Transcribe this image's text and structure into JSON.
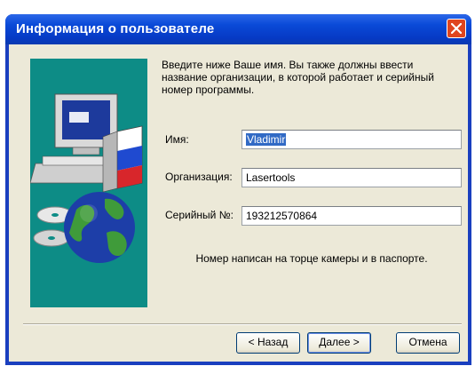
{
  "window": {
    "title": "Информация о пользователе"
  },
  "intro_text": "Введите ниже Ваше имя. Вы также должны ввести название организации, в которой работает и серийный номер программы.",
  "fields": {
    "name": {
      "label": "Имя:",
      "value": "Vladimir"
    },
    "organization": {
      "label": "Организация:",
      "value": "Lasertools"
    },
    "serial": {
      "label": "Серийный №:",
      "value": "193212570864"
    }
  },
  "note": "Номер написан на торце камеры и в паспорте.",
  "buttons": {
    "back": "< Назад",
    "next": "Далее >",
    "cancel": "Отмена"
  },
  "icons": {
    "side": "computer-with-globe-and-cd-art",
    "close": "close-icon"
  },
  "colors": {
    "accent": "#0a4ad8",
    "close": "#e0451f",
    "side_panel": "#0d8c86",
    "selection": "#316ac5"
  }
}
